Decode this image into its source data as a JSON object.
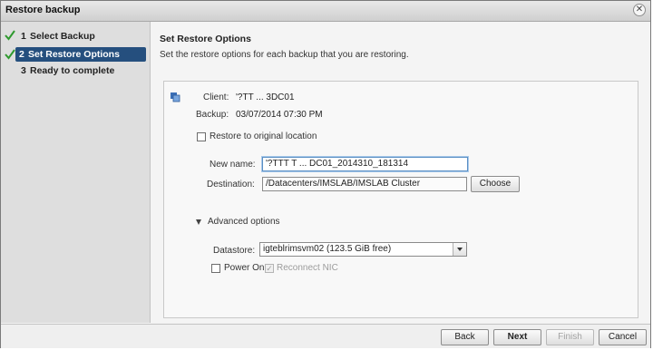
{
  "window": {
    "title": "Restore backup"
  },
  "steps": [
    {
      "num": "1",
      "label": "Select Backup",
      "done": true
    },
    {
      "num": "2",
      "label": "Set Restore Options",
      "done": true
    },
    {
      "num": "3",
      "label": "Ready to complete",
      "done": false
    }
  ],
  "main": {
    "heading": "Set Restore Options",
    "subheading": "Set the restore options for each backup that you are restoring."
  },
  "backup": {
    "client_label": "Client:",
    "client_value": "'?TT  ...  3DC01",
    "backup_label": "Backup:",
    "backup_value": "03/07/2014 07:30 PM"
  },
  "restore": {
    "original_location_label": "Restore to original location",
    "new_name_label": "New name:",
    "new_name_value": "'?TTT T  ...  DC01_2014310_181314",
    "destination_label": "Destination:",
    "destination_value": "/Datacenters/IMSLAB/IMSLAB Cluster",
    "choose_label": "Choose"
  },
  "advanced": {
    "label": "Advanced options",
    "datastore_label": "Datastore:",
    "datastore_value": "igteblrimsvm02 (123.5 GiB free)",
    "power_on_label": "Power On",
    "reconnect_nic_label": "Reconnect NIC"
  },
  "footer": {
    "back": "Back",
    "next": "Next",
    "finish": "Finish",
    "cancel": "Cancel"
  },
  "colors": {
    "active_step": "#254f7e",
    "check": "#2f9a2f"
  }
}
